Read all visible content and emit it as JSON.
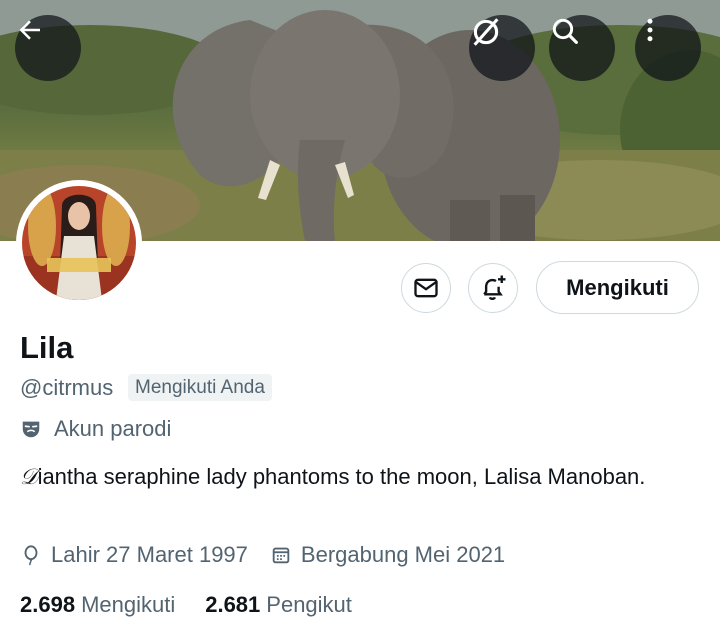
{
  "profile": {
    "name": "Lila",
    "handle": "@citrmus",
    "follows_you": "Mengikuti Anda",
    "parody_label": "Akun parodi",
    "bio_initial": "𝒟",
    "bio": "iantha seraphine lady phantoms to the moon, Lalisa Manoban.",
    "birthday": "Lahir 27 Maret 1997",
    "joined": "Bergabung Mei 2021"
  },
  "stats": {
    "following_count": "2.698",
    "following_label": "Mengikuti",
    "followers_count": "2.681",
    "followers_label": "Pengikut"
  },
  "actions": {
    "follow_label": "Mengikuti"
  },
  "header": {
    "icons": [
      "back-arrow-icon",
      "grok-icon",
      "search-icon",
      "more-vertical-icon"
    ]
  },
  "colors": {
    "text_primary": "#0f1419",
    "text_secondary": "#536471",
    "border": "#cfd9de",
    "badge_bg": "#eff3f4"
  }
}
